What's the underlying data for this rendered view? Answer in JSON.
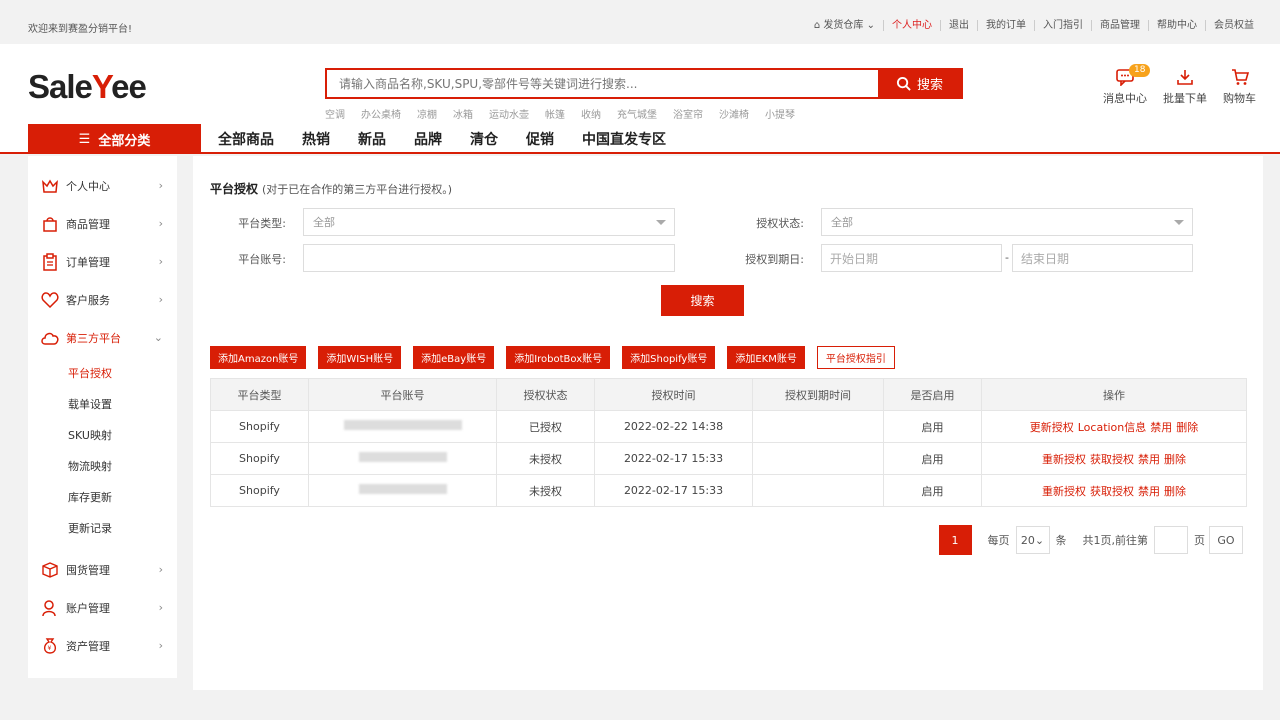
{
  "topbar": {
    "welcome": "欢迎来到赛盈分销平台!",
    "links": [
      "发货仓库",
      "个人中心",
      "退出",
      "我的订单",
      "入门指引",
      "商品管理",
      "帮助中心",
      "会员权益"
    ]
  },
  "header": {
    "logo_pre": "Sale",
    "logo_y": "Y",
    "logo_post": "ee",
    "search_placeholder": "请输入商品名称,SKU,SPU,零部件号等关键词进行搜索...",
    "search_button": "搜索",
    "hotwords": [
      "空调",
      "办公桌椅",
      "凉棚",
      "冰箱",
      "运动水壶",
      "帐篷",
      "收纳",
      "充气城堡",
      "浴室帘",
      "沙滩椅",
      "小提琴"
    ],
    "icons": {
      "messages": "消息中心",
      "messages_count": "18",
      "bulk_order": "批量下单",
      "cart": "购物车"
    }
  },
  "nav": {
    "all_categories": "全部分类",
    "items": [
      "全部商品",
      "热销",
      "新品",
      "品牌",
      "清仓",
      "促销",
      "中国直发专区"
    ]
  },
  "sidebar": {
    "items": [
      {
        "label": "个人中心",
        "icon": "crown-icon"
      },
      {
        "label": "商品管理",
        "icon": "bag-icon"
      },
      {
        "label": "订单管理",
        "icon": "clipboard-icon"
      },
      {
        "label": "客户服务",
        "icon": "heart-icon"
      },
      {
        "label": "第三方平台",
        "icon": "cloud-icon"
      }
    ],
    "subitems": [
      "平台授权",
      "载单设置",
      "SKU映射",
      "物流映射",
      "库存更新",
      "更新记录"
    ],
    "bottom_items": [
      {
        "label": "囤货管理",
        "icon": "box-icon"
      },
      {
        "label": "账户管理",
        "icon": "user-icon"
      },
      {
        "label": "资产管理",
        "icon": "money-bag-icon"
      }
    ]
  },
  "main": {
    "title": "平台授权",
    "subtitle": "(对于已在合作的第三方平台进行授权。)",
    "filters": {
      "platform_type_label": "平台类型:",
      "platform_type_value": "全部",
      "auth_status_label": "授权状态:",
      "auth_status_value": "全部",
      "account_label": "平台账号:",
      "expiry_label": "授权到期日:",
      "start_placeholder": "开始日期",
      "end_placeholder": "结束日期",
      "sep": "-",
      "search_button": "搜索"
    },
    "actions": [
      "添加Amazon账号",
      "添加WISH账号",
      "添加eBay账号",
      "添加IrobotBox账号",
      "添加Shopify账号",
      "添加EKM账号"
    ],
    "guide_button": "平台授权指引",
    "table": {
      "headers": [
        "平台类型",
        "平台账号",
        "授权状态",
        "授权时间",
        "授权到期时间",
        "是否启用",
        "操作"
      ],
      "rows": [
        {
          "platform": "Shopify",
          "status": "已授权",
          "time": "2022-02-22 14:38",
          "enabled": "启用",
          "ops": [
            "更新授权",
            "Location信息",
            "禁用",
            "删除"
          ]
        },
        {
          "platform": "Shopify",
          "status": "未授权",
          "time": "2022-02-17 15:33",
          "enabled": "启用",
          "ops": [
            "重新授权",
            "获取授权",
            "禁用",
            "删除"
          ]
        },
        {
          "platform": "Shopify",
          "status": "未授权",
          "time": "2022-02-17 15:33",
          "enabled": "启用",
          "ops": [
            "重新授权",
            "获取授权",
            "禁用",
            "删除"
          ]
        }
      ]
    },
    "pager": {
      "current": "1",
      "per_page_label": "每页",
      "per_page": "20",
      "unit": "条",
      "total": "共1页,前往第",
      "page_unit": "页",
      "go": "GO"
    }
  },
  "colors": {
    "accent": "#d81e06",
    "badge": "#f7a21b"
  }
}
